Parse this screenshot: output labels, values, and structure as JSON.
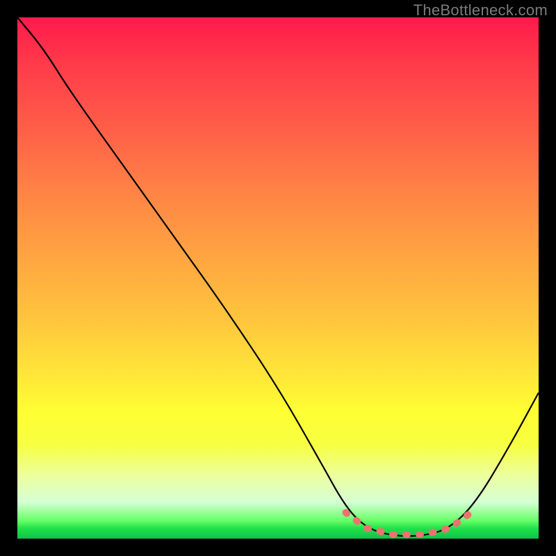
{
  "watermark": "TheBottleneck.com",
  "chart_data": {
    "type": "line",
    "title": "",
    "xlabel": "",
    "ylabel": "",
    "xlim": [
      0,
      100
    ],
    "ylim": [
      0,
      100
    ],
    "background_gradient_stops": [
      {
        "pos": 0,
        "color": "#ff1a4b"
      },
      {
        "pos": 10,
        "color": "#ff3e4a"
      },
      {
        "pos": 22,
        "color": "#ff6048"
      },
      {
        "pos": 34,
        "color": "#ff8545"
      },
      {
        "pos": 46,
        "color": "#ffa541"
      },
      {
        "pos": 58,
        "color": "#ffc53d"
      },
      {
        "pos": 68,
        "color": "#ffe439"
      },
      {
        "pos": 76,
        "color": "#ffff33"
      },
      {
        "pos": 82,
        "color": "#f7ff40"
      },
      {
        "pos": 88,
        "color": "#ecffa0"
      },
      {
        "pos": 93,
        "color": "#d5ffd5"
      },
      {
        "pos": 96.5,
        "color": "#69ff69"
      },
      {
        "pos": 98,
        "color": "#20e24a"
      },
      {
        "pos": 100,
        "color": "#11c24a"
      }
    ],
    "series": [
      {
        "name": "black-curve",
        "color": "#000000",
        "points": [
          {
            "x": 0,
            "y": 100
          },
          {
            "x": 5,
            "y": 94
          },
          {
            "x": 10,
            "y": 86
          },
          {
            "x": 20,
            "y": 72
          },
          {
            "x": 30,
            "y": 58
          },
          {
            "x": 40,
            "y": 44
          },
          {
            "x": 50,
            "y": 29
          },
          {
            "x": 58,
            "y": 15
          },
          {
            "x": 63,
            "y": 6
          },
          {
            "x": 67,
            "y": 2
          },
          {
            "x": 72,
            "y": 0.5
          },
          {
            "x": 78,
            "y": 0.5
          },
          {
            "x": 83,
            "y": 2
          },
          {
            "x": 88,
            "y": 7
          },
          {
            "x": 94,
            "y": 17
          },
          {
            "x": 100,
            "y": 28
          }
        ]
      },
      {
        "name": "pink-highlight-band",
        "color": "#e9746f",
        "style": "dotted",
        "points": [
          {
            "x": 63,
            "y": 5
          },
          {
            "x": 67,
            "y": 2
          },
          {
            "x": 72,
            "y": 0.8
          },
          {
            "x": 78,
            "y": 0.8
          },
          {
            "x": 83,
            "y": 2
          },
          {
            "x": 87,
            "y": 5
          }
        ]
      }
    ]
  }
}
